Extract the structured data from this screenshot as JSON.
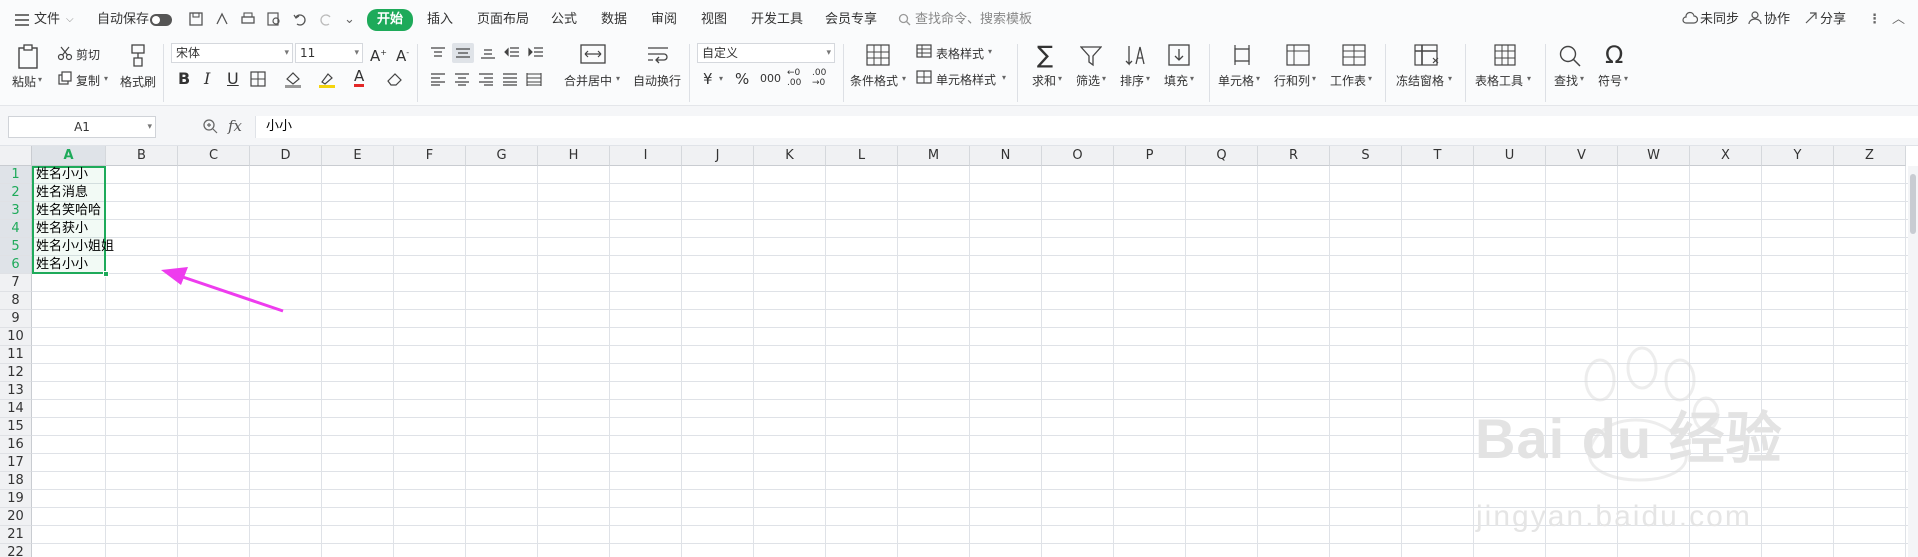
{
  "menubar": {
    "file": "文件",
    "autosave": "自动保存",
    "tabs": [
      "开始",
      "插入",
      "页面布局",
      "公式",
      "数据",
      "审阅",
      "视图",
      "开发工具",
      "会员专享"
    ],
    "search_placeholder": "查找命令、搜索模板",
    "right": {
      "unsynced": "未同步",
      "collab": "协作",
      "share": "分享"
    }
  },
  "ribbon": {
    "paste": "粘贴",
    "cut": "剪切",
    "copy": "复制",
    "format_painter": "格式刷",
    "font_name": "宋体",
    "font_size": "11",
    "merge_center": "合并居中",
    "wrap_text": "自动换行",
    "number_format": "自定义",
    "conditional_format": "条件格式",
    "table_style": "表格样式",
    "cell_style": "单元格样式",
    "sum": "求和",
    "filter": "筛选",
    "sort": "排序",
    "fill": "填充",
    "cell": "单元格",
    "row_col": "行和列",
    "worksheet": "工作表",
    "freeze": "冻结窗格",
    "table_tools": "表格工具",
    "find": "查找",
    "symbol": "符号",
    "currency": "¥",
    "percent": "%",
    "thousands": "000"
  },
  "formula_bar": {
    "name_box": "A1",
    "fx": "fx",
    "content": "小小"
  },
  "sheet": {
    "columns": [
      "A",
      "B",
      "C",
      "D",
      "E",
      "F",
      "G",
      "H",
      "I",
      "J",
      "K",
      "L",
      "M",
      "N",
      "O",
      "P",
      "Q",
      "R",
      "S",
      "T",
      "U",
      "V",
      "W",
      "X",
      "Y",
      "Z"
    ],
    "rows": [
      "1",
      "2",
      "3",
      "4",
      "5",
      "6",
      "7",
      "8",
      "9",
      "10",
      "11",
      "12",
      "13",
      "14",
      "15",
      "16",
      "17",
      "18",
      "19",
      "20",
      "21",
      "22"
    ],
    "cells": [
      "姓名小小",
      "姓名消息",
      "姓名笑哈哈",
      "姓名获小",
      "姓名小小姐姐",
      "姓名小小"
    ],
    "selected_column": "A",
    "selected_rows": [
      "1",
      "2",
      "3",
      "4",
      "5",
      "6"
    ]
  },
  "watermark": {
    "brand": "Bai du 经验",
    "url": "jingyan.baidu.com"
  },
  "colors": {
    "accent": "#1eaa5a",
    "arrow": "#ee3cee"
  }
}
